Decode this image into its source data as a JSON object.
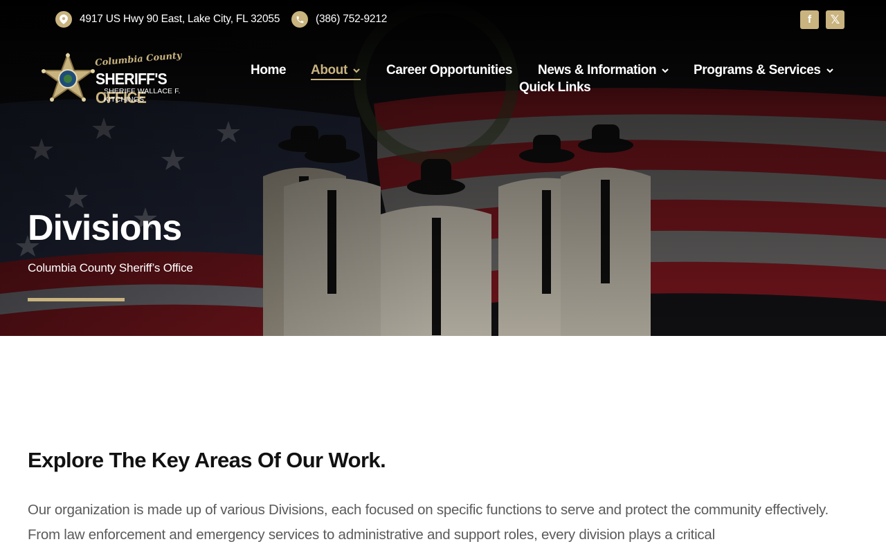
{
  "colors": {
    "accent": "#c9b37e",
    "nav_text": "#ffffff",
    "heading": "#111111",
    "body_text": "#5a5a5a"
  },
  "topbar": {
    "address_icon": "map-pin-icon",
    "address": "4917 US Hwy 90 East, Lake City, FL 32055",
    "phone_icon": "phone-icon",
    "phone": "(386) 752-9212",
    "social": [
      {
        "icon": "facebook-icon",
        "glyph": "f"
      },
      {
        "icon": "x-twitter-icon",
        "glyph": "𝕏"
      }
    ]
  },
  "logo": {
    "line1": "Columbia County",
    "line2_a": "SHERIFF'S ",
    "line2_b": "OFFICE",
    "line3": "SHERIFF WALLACE F. KITCHINGS"
  },
  "nav": {
    "items": [
      {
        "label": "Home",
        "has_dropdown": false,
        "active": false
      },
      {
        "label": "About",
        "has_dropdown": true,
        "active": true
      },
      {
        "label": "Career Opportunities",
        "has_dropdown": false,
        "active": false
      },
      {
        "label": "News & Information",
        "has_dropdown": true,
        "active": false
      },
      {
        "label": "Programs & Services",
        "has_dropdown": true,
        "active": false
      },
      {
        "label": "Quick Links",
        "has_dropdown": false,
        "active": false
      }
    ]
  },
  "hero": {
    "title": "Divisions",
    "subtitle": "Columbia County Sheriff’s Office"
  },
  "content": {
    "heading": "Explore The Key Areas Of Our Work.",
    "body": "Our organization is made up of various Divisions, each focused on specific functions to serve and protect the community effectively. From law enforcement and emergency services to administrative and support roles, every division plays a critical"
  }
}
